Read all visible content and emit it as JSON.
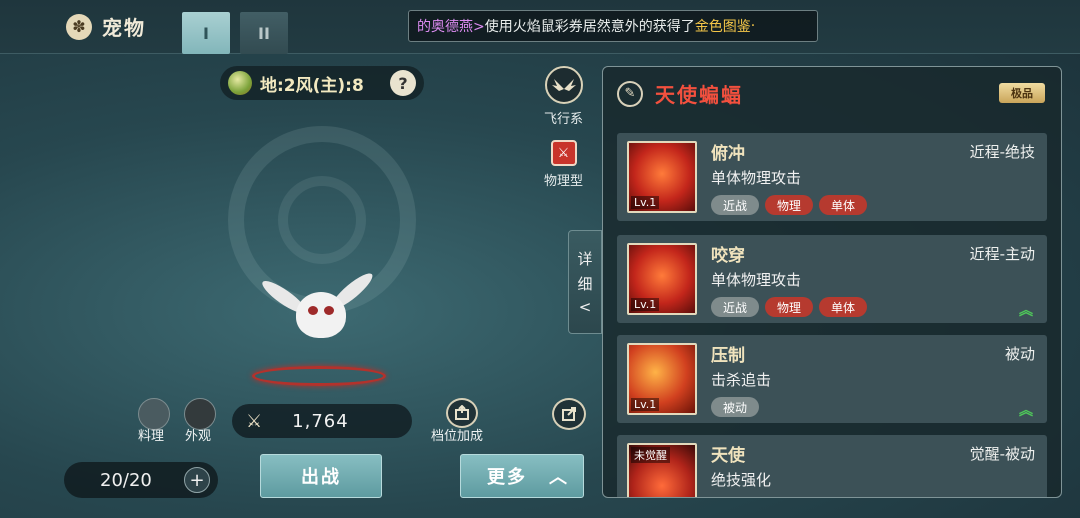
{
  "header": {
    "title": "宠物",
    "tabs": [
      "I",
      "II"
    ],
    "ticker": {
      "pet": "的奥德燕>",
      "message": "使用火焰鼠彩券居然意外的获得了",
      "highlight": "金色图鉴",
      "tail": "·"
    }
  },
  "element": {
    "text": "地:2风(主):8",
    "help": "?"
  },
  "pet_types": {
    "flying_label": "飞行系",
    "physical_label": "物理型"
  },
  "bottom_left": {
    "cooking_label": "料理",
    "appearance_label": "外观",
    "power_value": "1,764",
    "slot_bonus_label": "档位加成",
    "count": "20/20",
    "plus": "+",
    "battle_label": "出战",
    "more_label": "更多",
    "more_chevron": "︿"
  },
  "detail_tab": {
    "chars": [
      "详",
      "细"
    ],
    "arrow": "<"
  },
  "panel": {
    "pet_name": "天使蝙蝠",
    "grade": "极品",
    "skills": [
      {
        "name": "俯冲",
        "type": "近程-绝技",
        "desc": "单体物理攻击",
        "level": "Lv.1",
        "tags": [
          {
            "text": "近战",
            "style": "gray"
          },
          {
            "text": "物理",
            "style": "red"
          },
          {
            "text": "单体",
            "style": "red"
          }
        ],
        "upgrade": false
      },
      {
        "name": "咬穿",
        "type": "近程-主动",
        "desc": "单体物理攻击",
        "level": "Lv.1",
        "tags": [
          {
            "text": "近战",
            "style": "gray"
          },
          {
            "text": "物理",
            "style": "red"
          },
          {
            "text": "单体",
            "style": "red"
          }
        ],
        "upgrade": true
      },
      {
        "name": "压制",
        "type": "被动",
        "desc": "击杀追击",
        "level": "Lv.1",
        "tags": [
          {
            "text": "被动",
            "style": "gray"
          }
        ],
        "upgrade": true
      },
      {
        "name": "天使",
        "type": "觉醒-被动",
        "desc": "绝技强化",
        "level": "未觉醒",
        "tags": [],
        "upgrade": false
      }
    ]
  },
  "colors": {
    "accent_teal": "#5e9ba0",
    "name_red": "#f3503e",
    "upgrade_green": "#4fc85a"
  }
}
